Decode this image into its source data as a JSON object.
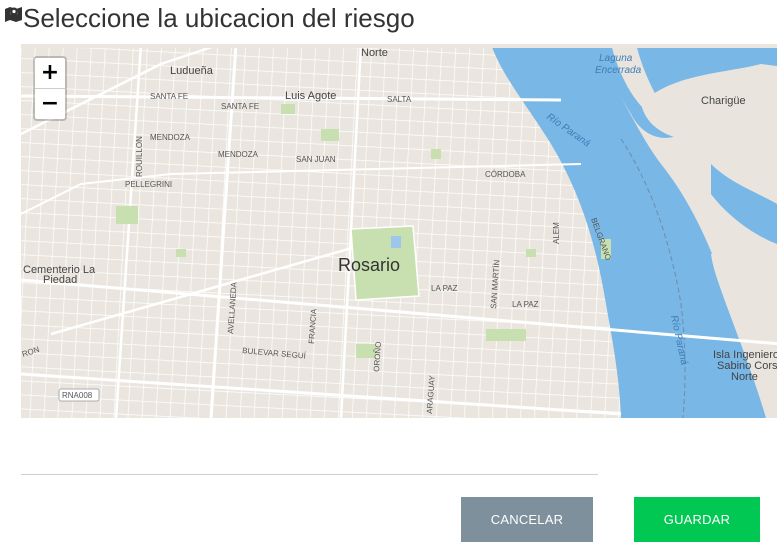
{
  "header": {
    "title": "Seleccione la ubicacion del riesgo",
    "icon": "map-marker-icon"
  },
  "map": {
    "zoom_in": "+",
    "zoom_out": "−",
    "city": "Rosario",
    "places": {
      "norte": "Norte",
      "luduena": "Ludueña",
      "luis_agote": "Luis Agote",
      "charigue": "Charigüe",
      "laguna": "Laguna",
      "encerrada": "Encerrada",
      "cementerio_1": "Cementerio La",
      "cementerio_2": "Piedad",
      "isla_1": "Isla Ingeniero",
      "isla_2": "Sabino Corsi",
      "isla_3": "Norte"
    },
    "streets": {
      "santa_fe_1": "SANTA FE",
      "santa_fe_2": "SANTA FE",
      "salta": "SALTA",
      "mendoza_1": "MENDOZA",
      "mendoza_2": "MENDOZA",
      "san_juan": "SAN JUAN",
      "cordoba": "CÓRDOBA",
      "pellegrini": "PELLEGRINI",
      "rouillon": "ROUILLON",
      "alem": "ALEM",
      "belgrano": "BELGRANO",
      "la_paz_1": "LA PAZ",
      "la_paz_2": "LA PAZ",
      "san_martin": "SAN MARTÍN",
      "avellaneda": "AVELLANEDA",
      "francia": "FRANCIA",
      "oroño": "OROÑO",
      "bulevar_segui": "BULEVAR SEGUÍ",
      "paraguay": "ARAGUAY",
      "rna008": "RNA008",
      "ron": "RON",
      "rio_parana_1": "Río Paraná",
      "rio_parana_2": "Río Paraná"
    }
  },
  "actions": {
    "cancel": "CANCELAR",
    "save": "GUARDAR"
  },
  "colors": {
    "cancel_bg": "#7d909c",
    "save_bg": "#00c853",
    "water": "#78b7e6",
    "land": "#eae6df"
  }
}
